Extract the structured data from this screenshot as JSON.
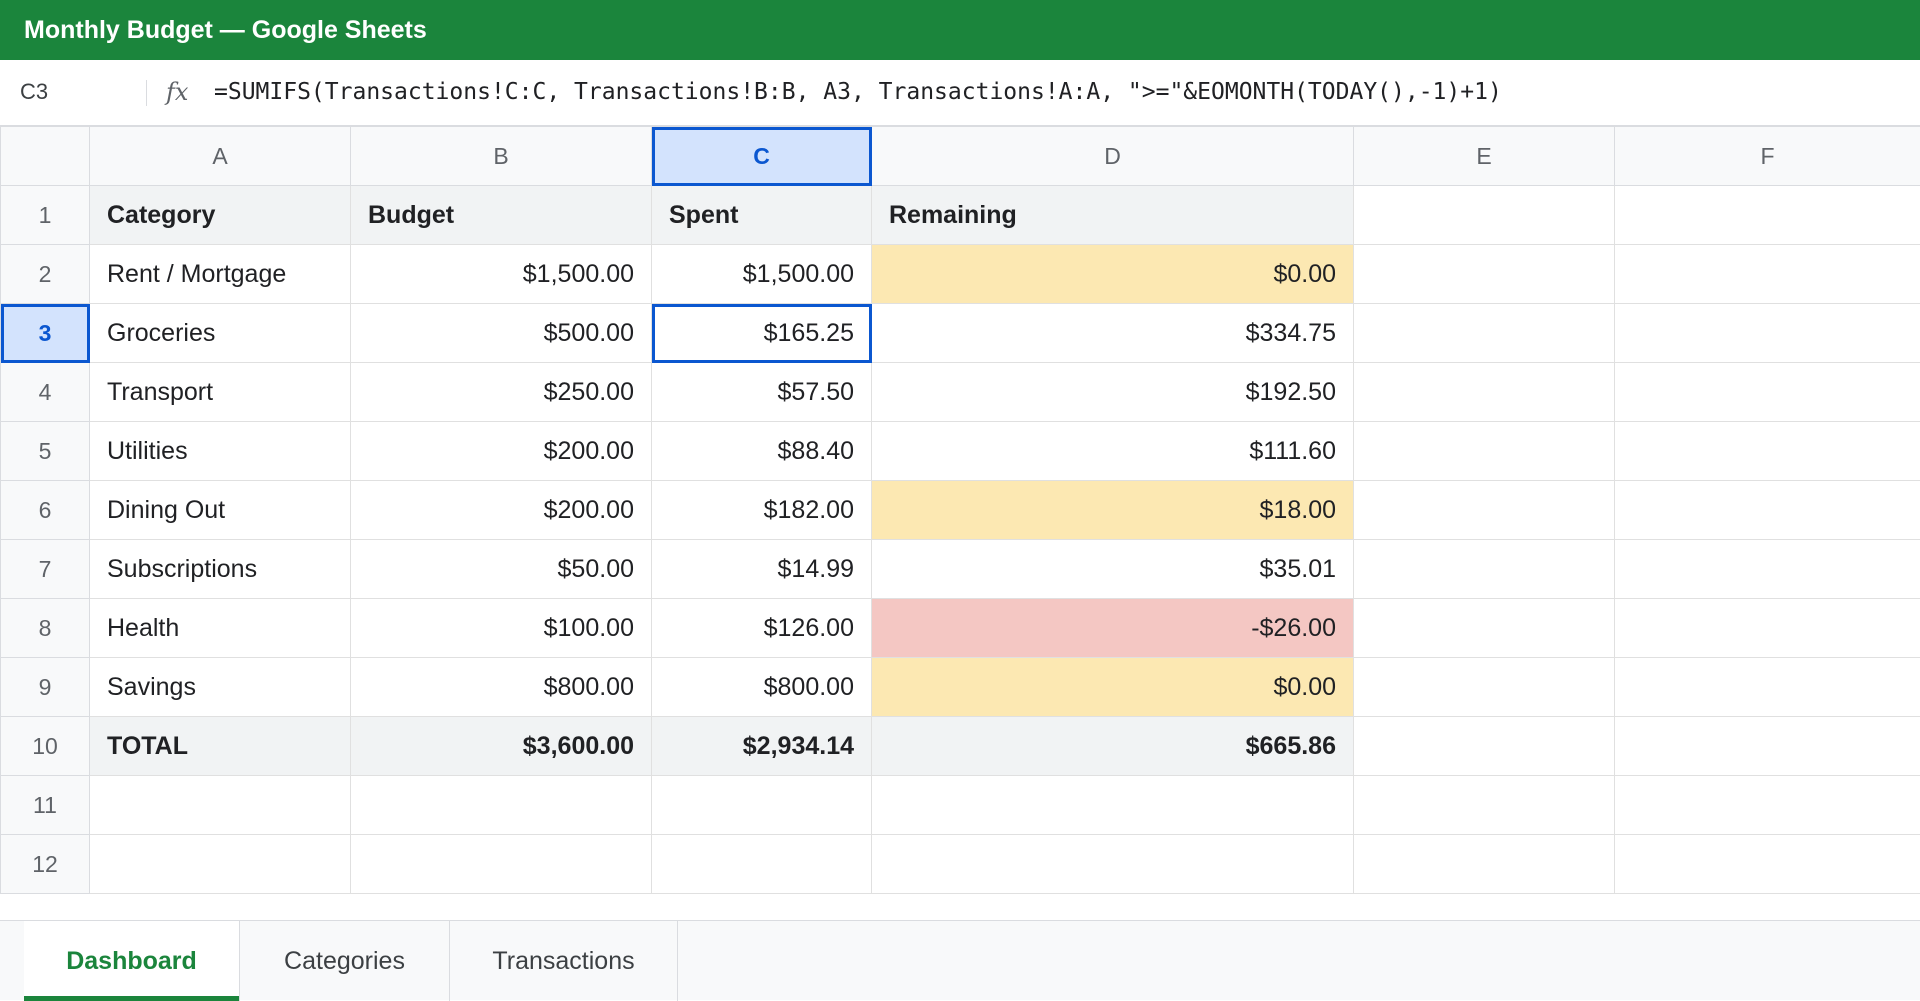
{
  "window": {
    "title": "Monthly Budget — Google Sheets"
  },
  "formula_bar": {
    "cell_ref": "C3",
    "fx_label": "fx",
    "formula": "=SUMIFS(Transactions!C:C, Transactions!B:B, A3, Transactions!A:A, \">=\"&EOMONTH(TODAY(),-1)+1)"
  },
  "columns": [
    "A",
    "B",
    "C",
    "D",
    "E",
    "F"
  ],
  "active_column": "C",
  "active_row": 3,
  "rows": [
    {
      "num": "1",
      "cells": [
        "Category",
        "Budget",
        "Spent",
        "Remaining"
      ]
    },
    {
      "num": "2",
      "cells": [
        "Rent / Mortgage",
        "$1,500.00",
        "$1,500.00",
        "$0.00"
      ]
    },
    {
      "num": "3",
      "cells": [
        "Groceries",
        "$500.00",
        "$165.25",
        "$334.75"
      ]
    },
    {
      "num": "4",
      "cells": [
        "Transport",
        "$250.00",
        "$57.50",
        "$192.50"
      ]
    },
    {
      "num": "5",
      "cells": [
        "Utilities",
        "$200.00",
        "$88.40",
        "$111.60"
      ]
    },
    {
      "num": "6",
      "cells": [
        "Dining Out",
        "$200.00",
        "$182.00",
        "$18.00"
      ]
    },
    {
      "num": "7",
      "cells": [
        "Subscriptions",
        "$50.00",
        "$14.99",
        "$35.01"
      ]
    },
    {
      "num": "8",
      "cells": [
        "Health",
        "$100.00",
        "$126.00",
        "-$26.00"
      ]
    },
    {
      "num": "9",
      "cells": [
        "Savings",
        "$800.00",
        "$800.00",
        "$0.00"
      ]
    },
    {
      "num": "10",
      "cells": [
        "TOTAL",
        "$3,600.00",
        "$2,934.14",
        "$665.86"
      ]
    },
    {
      "num": "11",
      "cells": [
        "",
        "",
        "",
        ""
      ]
    },
    {
      "num": "12",
      "cells": [
        "",
        "",
        "",
        ""
      ]
    }
  ],
  "sheet_tabs": [
    {
      "label": "Dashboard",
      "active": true
    },
    {
      "label": "Categories",
      "active": false
    },
    {
      "label": "Transactions",
      "active": false
    }
  ],
  "colors": {
    "brand": "#1b853c",
    "selection": "#0b57d0",
    "warning_fill": "#fce8b2",
    "over_budget_fill": "#f4c7c3"
  }
}
